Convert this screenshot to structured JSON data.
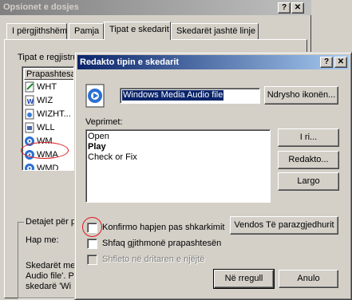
{
  "back_window": {
    "title": "Opsionet e dosjes",
    "help_button": "?",
    "close_button": "✕",
    "tabs": [
      {
        "label": "I përgjithshëm"
      },
      {
        "label": "Pamja"
      },
      {
        "label": "Tipat e skedarit"
      },
      {
        "label": "Skedarët jashtë linje"
      }
    ],
    "registered_label": "Tipat e regjistru",
    "list_header": "Prapashtesat",
    "extensions": [
      {
        "ext": "WHT",
        "icon": "document-pen-icon"
      },
      {
        "ext": "WIZ",
        "icon": "word-document-icon"
      },
      {
        "ext": "WIZHT...",
        "icon": "html-document-icon"
      },
      {
        "ext": "WLL",
        "icon": "generic-document-icon"
      },
      {
        "ext": "WM",
        "icon": "media-player-icon"
      },
      {
        "ext": "WMA",
        "icon": "media-player-icon"
      },
      {
        "ext": "WMD",
        "icon": "media-player-icon"
      }
    ],
    "details_group_label": "Detajet për p",
    "opens_with_label": "Hap me:",
    "details_text_lines": [
      "Skedarët me",
      "Audio file'. Pa",
      "skedarë 'Wi"
    ]
  },
  "dialog": {
    "title": "Redakto tipin e skedarit",
    "help_button": "?",
    "close_button": "✕",
    "type_name_value": "Windows Media Audio file",
    "change_icon_button": "Ndrysho ikonën...",
    "actions_label": "Veprimet:",
    "actions": [
      "Open",
      "Play",
      "Check or Fix"
    ],
    "default_action": "Play",
    "new_button": "I ri...",
    "edit_button": "Redakto...",
    "remove_button": "Largo",
    "set_default_button": "Vendos Të parazgjedhurit",
    "confirm_open_label": "Konfirmo hapjen pas shkarkimit",
    "always_show_ext_label": "Shfaq gjithmonë prapashtesën",
    "browse_same_window_label": "Shfleto në dritaren e njëjtë",
    "ok_button": "Në rregull",
    "cancel_button": "Anulo"
  }
}
